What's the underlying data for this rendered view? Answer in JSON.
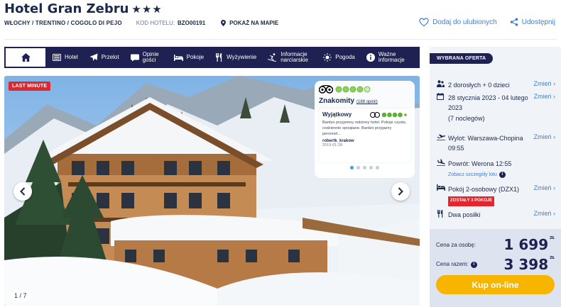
{
  "hotel": {
    "name": "Hotel Gran Zebru",
    "stars": "★★★",
    "location": "WŁOCHY / TRENTINO / COGOLO DI PEJO",
    "code_label": "KOD HOTELU:",
    "code_value": "BZO00191",
    "map_label": "POKAŻ NA MAPIE"
  },
  "header_actions": {
    "favorite": "Dodaj do ulubionych",
    "share": "Udostępnij"
  },
  "nav": {
    "items": [
      {
        "label": "Hotel",
        "icon": "hotel-icon"
      },
      {
        "label": "Przelot",
        "icon": "plane-icon"
      },
      {
        "label": "Opinie gości",
        "icon": "chat-icon"
      },
      {
        "label": "Pokoje",
        "icon": "bed-icon"
      },
      {
        "label": "Wyżywienie",
        "icon": "cutlery-icon"
      },
      {
        "label": "Informacje narciarskie",
        "icon": "skier-icon"
      },
      {
        "label": "Pogoda",
        "icon": "sun-icon"
      },
      {
        "label": "Ważne informacje",
        "icon": "info-icon"
      }
    ]
  },
  "gallery": {
    "badge": "LAST MINUTE",
    "counter": "1 / 7",
    "review": {
      "rating_label": "Znakomity",
      "count": "(188 opinii)",
      "item_title": "Wyjątkowy",
      "item_text": "Bardzo przyjemny rodzinny hotel. Pokoje czyste, codziennie sprzątane. Bardzo przyjazny personel...",
      "author": "robertk_krakow",
      "date": "2019-01-28"
    }
  },
  "offer": {
    "badge": "WYBRANA OFERTA",
    "change_label": "Zmień",
    "guests": "2 dorosłych + 0 dzieci",
    "dates": "28 stycznia 2023 - 04 lutego 2023",
    "nights": "(7 noclegów)",
    "departure": "Wylot: Warszawa-Chopina 09:55",
    "return": "Powrót: Werona 12:55",
    "flight_details": "Zobacz szczegóły lotu",
    "room": "Pokój 2-osobowy (DZX1)",
    "rooms_left": "ZOSTAŁY 3 POKOJE",
    "board": "Dwa posiłki",
    "price_per_person_label": "Cena za osobę:",
    "price_per_person": "1 699",
    "price_total_label": "Cena razem:",
    "price_total": "3 398",
    "currency": "ZŁ",
    "buy_button": "Kup on-line"
  }
}
